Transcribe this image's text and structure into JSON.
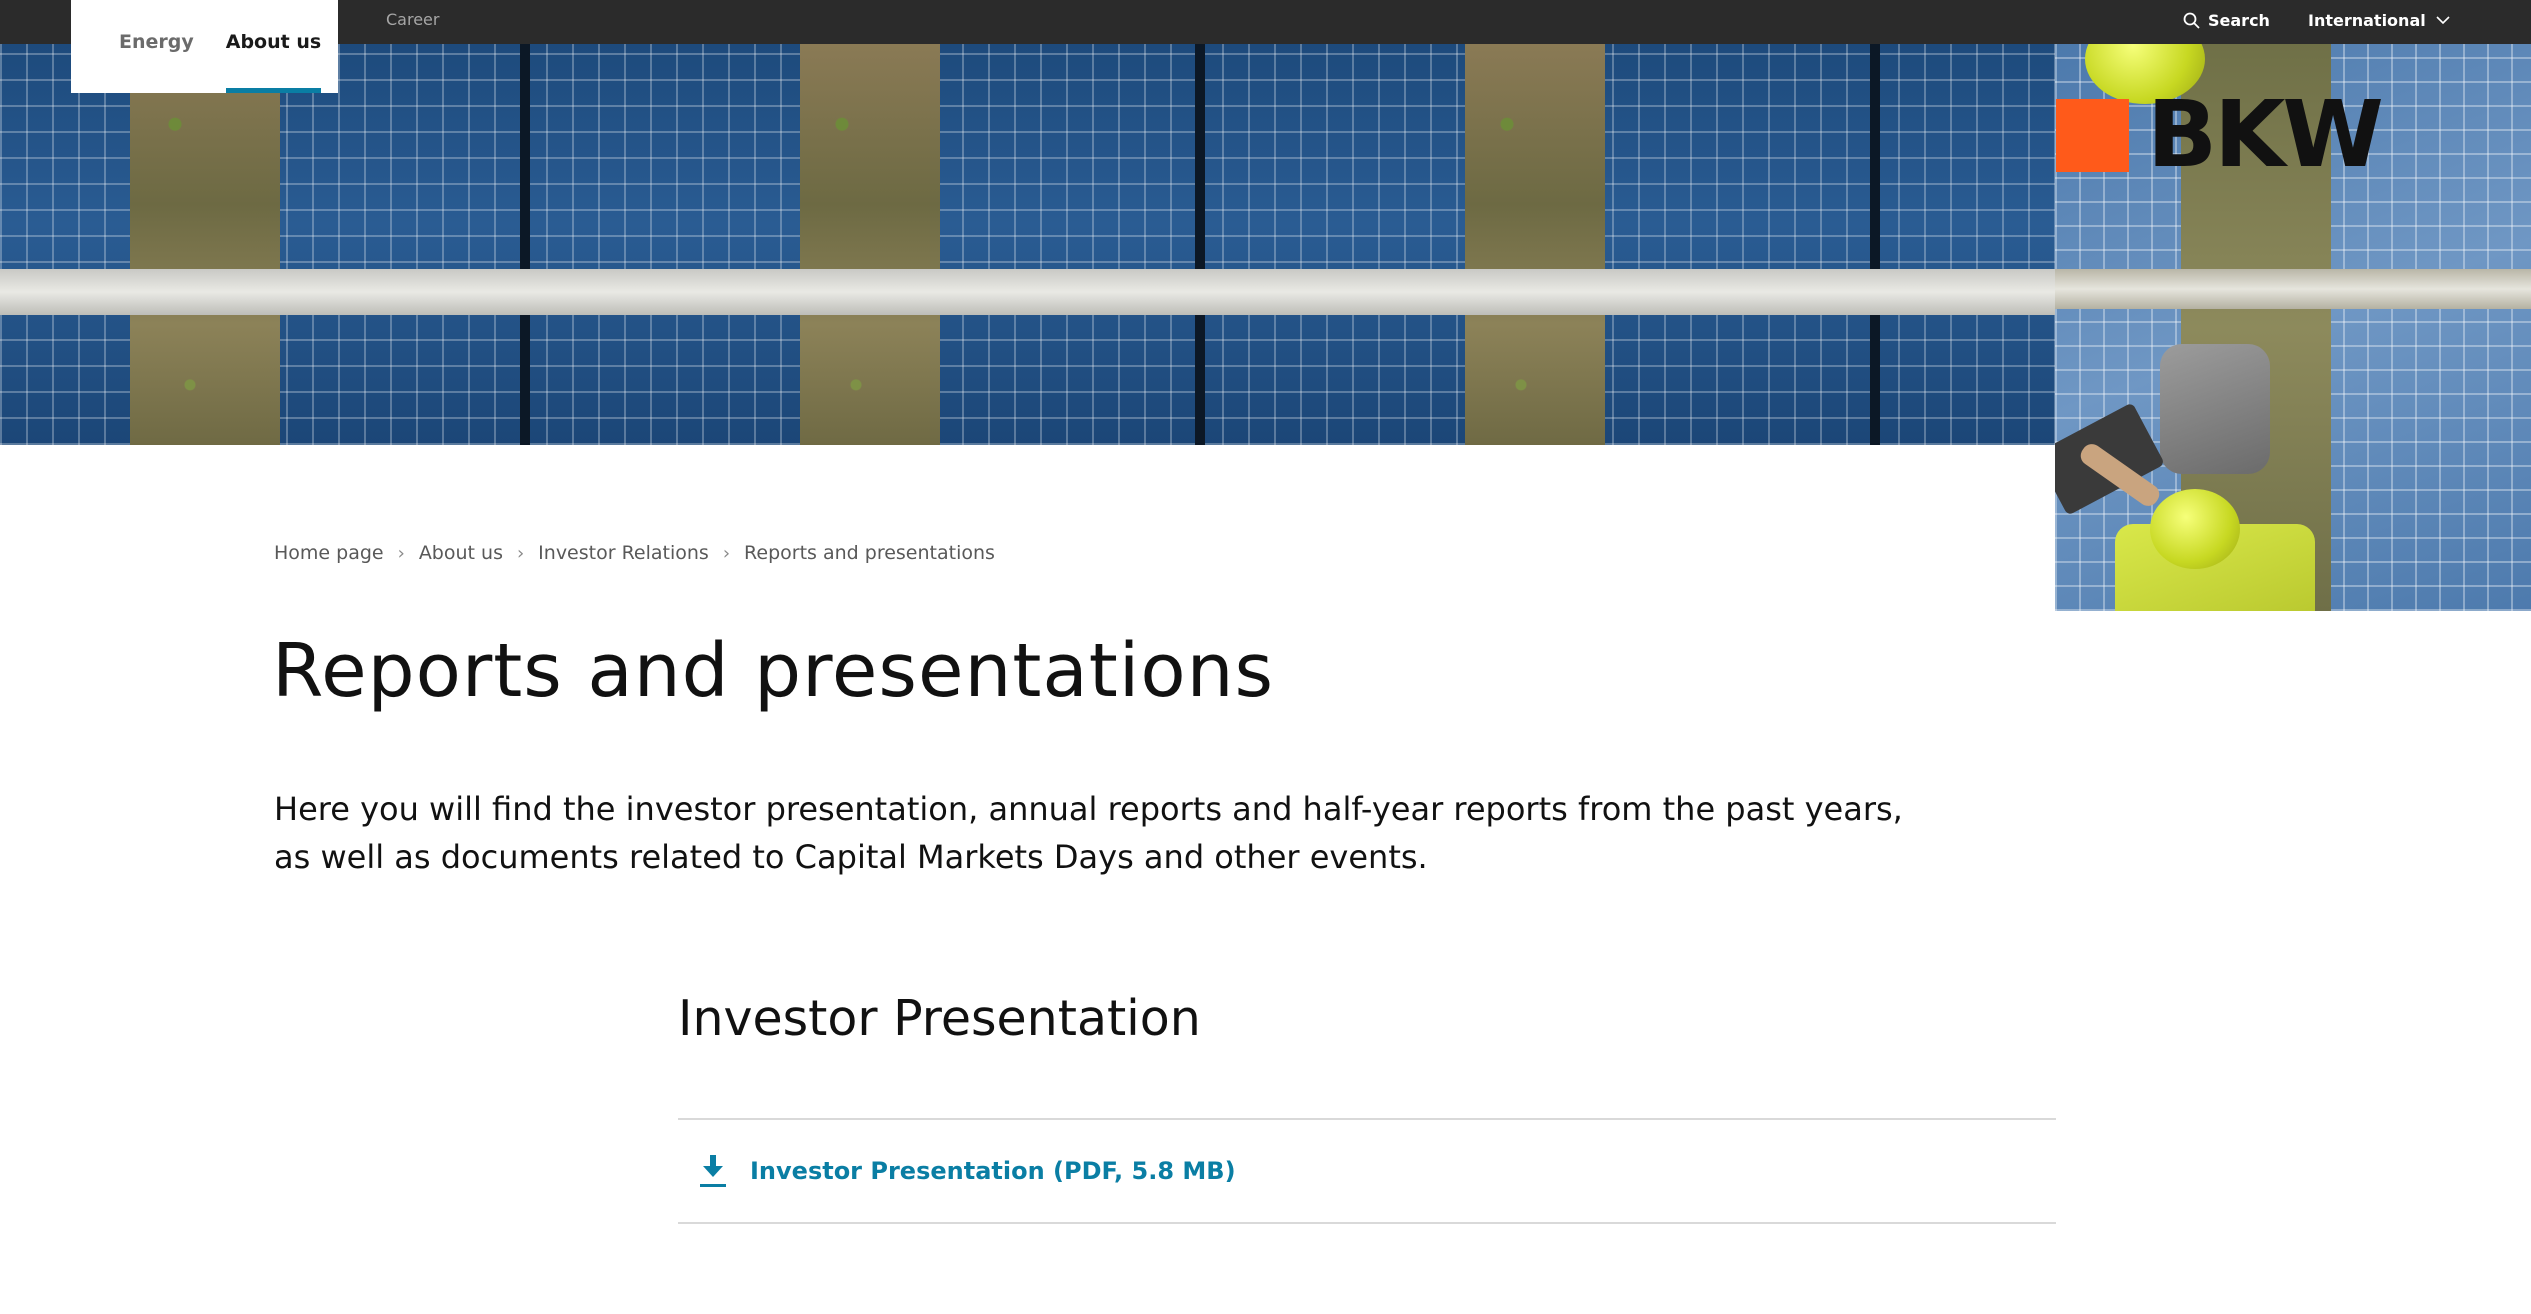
{
  "topbar": {
    "career_label": "Career",
    "search_label": "Search",
    "international_label": "International"
  },
  "primary_nav": [
    {
      "label": "Energy",
      "active": false
    },
    {
      "label": "About us",
      "active": true
    }
  ],
  "brand": {
    "logo_text": "BKW",
    "accent_color": "#ff5a1a",
    "link_color": "#0a7ea4"
  },
  "hero": {
    "image_subject": "aerial view of solar panels with technicians"
  },
  "breadcrumb": [
    "Home page",
    "About us",
    "Investor Relations",
    "Reports and presentations"
  ],
  "page": {
    "title": "Reports and presentations",
    "intro": "Here you will find the investor presentation, annual reports and half-year reports from the past years, as well as documents related to Capital Markets Days and other events."
  },
  "sections": [
    {
      "title": "Investor Presentation",
      "downloads": [
        {
          "label": "Investor Presentation (PDF, 5.8 MB)",
          "icon": "download-icon"
        }
      ]
    }
  ]
}
